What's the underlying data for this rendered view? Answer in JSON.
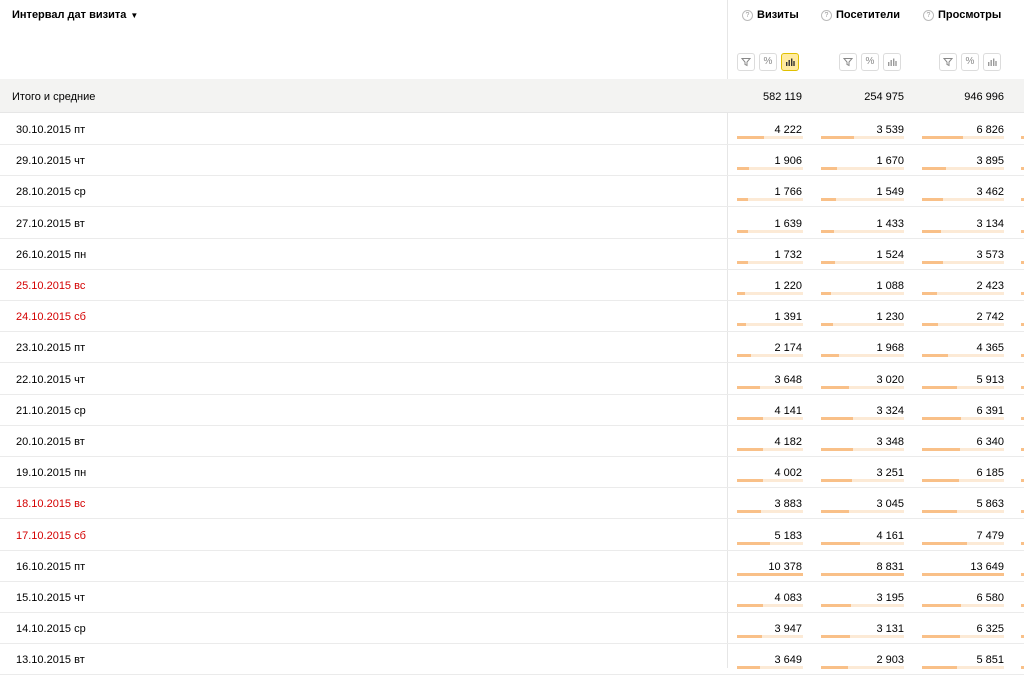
{
  "dimension": {
    "title": "Интервал дат визита",
    "arrow": "▼"
  },
  "metrics": [
    {
      "name": "Визиты",
      "help": "?",
      "percent_label": "%",
      "chart_active": true
    },
    {
      "name": "Посетители",
      "help": "?",
      "percent_label": "%",
      "chart_active": false
    },
    {
      "name": "Просмотры",
      "help": "?",
      "percent_label": "%",
      "chart_active": false
    }
  ],
  "totals": {
    "label": "Итого и средние",
    "values": [
      "582 119",
      "254 975",
      "946 996"
    ]
  },
  "rows": [
    {
      "date": "30.10.2015 пт",
      "weekend": false,
      "values": [
        "4 222",
        "3 539",
        "6 826"
      ],
      "fractions": [
        0.41,
        0.4,
        0.5
      ]
    },
    {
      "date": "29.10.2015 чт",
      "weekend": false,
      "values": [
        "1 906",
        "1 670",
        "3 895"
      ],
      "fractions": [
        0.18,
        0.19,
        0.29
      ]
    },
    {
      "date": "28.10.2015 ср",
      "weekend": false,
      "values": [
        "1 766",
        "1 549",
        "3 462"
      ],
      "fractions": [
        0.17,
        0.18,
        0.25
      ]
    },
    {
      "date": "27.10.2015 вт",
      "weekend": false,
      "values": [
        "1 639",
        "1 433",
        "3 134"
      ],
      "fractions": [
        0.16,
        0.16,
        0.23
      ]
    },
    {
      "date": "26.10.2015 пн",
      "weekend": false,
      "values": [
        "1 732",
        "1 524",
        "3 573"
      ],
      "fractions": [
        0.17,
        0.17,
        0.26
      ]
    },
    {
      "date": "25.10.2015 вс",
      "weekend": true,
      "values": [
        "1 220",
        "1 088",
        "2 423"
      ],
      "fractions": [
        0.12,
        0.12,
        0.18
      ]
    },
    {
      "date": "24.10.2015 сб",
      "weekend": true,
      "values": [
        "1 391",
        "1 230",
        "2 742"
      ],
      "fractions": [
        0.13,
        0.14,
        0.2
      ]
    },
    {
      "date": "23.10.2015 пт",
      "weekend": false,
      "values": [
        "2 174",
        "1 968",
        "4 365"
      ],
      "fractions": [
        0.21,
        0.22,
        0.32
      ]
    },
    {
      "date": "22.10.2015 чт",
      "weekend": false,
      "values": [
        "3 648",
        "3 020",
        "5 913"
      ],
      "fractions": [
        0.35,
        0.34,
        0.43
      ]
    },
    {
      "date": "21.10.2015 ср",
      "weekend": false,
      "values": [
        "4 141",
        "3 324",
        "6 391"
      ],
      "fractions": [
        0.4,
        0.38,
        0.47
      ]
    },
    {
      "date": "20.10.2015 вт",
      "weekend": false,
      "values": [
        "4 182",
        "3 348",
        "6 340"
      ],
      "fractions": [
        0.4,
        0.38,
        0.46
      ]
    },
    {
      "date": "19.10.2015 пн",
      "weekend": false,
      "values": [
        "4 002",
        "3 251",
        "6 185"
      ],
      "fractions": [
        0.39,
        0.37,
        0.45
      ]
    },
    {
      "date": "18.10.2015 вс",
      "weekend": true,
      "values": [
        "3 883",
        "3 045",
        "5 863"
      ],
      "fractions": [
        0.37,
        0.34,
        0.43
      ]
    },
    {
      "date": "17.10.2015 сб",
      "weekend": true,
      "values": [
        "5 183",
        "4 161",
        "7 479"
      ],
      "fractions": [
        0.5,
        0.47,
        0.55
      ]
    },
    {
      "date": "16.10.2015 пт",
      "weekend": false,
      "values": [
        "10 378",
        "8 831",
        "13 649"
      ],
      "fractions": [
        1.0,
        1.0,
        1.0
      ]
    },
    {
      "date": "15.10.2015 чт",
      "weekend": false,
      "values": [
        "4 083",
        "3 195",
        "6 580"
      ],
      "fractions": [
        0.39,
        0.36,
        0.48
      ]
    },
    {
      "date": "14.10.2015 ср",
      "weekend": false,
      "values": [
        "3 947",
        "3 131",
        "6 325"
      ],
      "fractions": [
        0.38,
        0.35,
        0.46
      ]
    },
    {
      "date": "13.10.2015 вт",
      "weekend": false,
      "values": [
        "3 649",
        "2 903",
        "5 851"
      ],
      "fractions": [
        0.35,
        0.33,
        0.43
      ]
    }
  ],
  "colors": {
    "bar_fill": "#f9c088",
    "bar_track": "#fcead6",
    "weekend_text": "#d40000",
    "active_button": "#ffeba0"
  }
}
